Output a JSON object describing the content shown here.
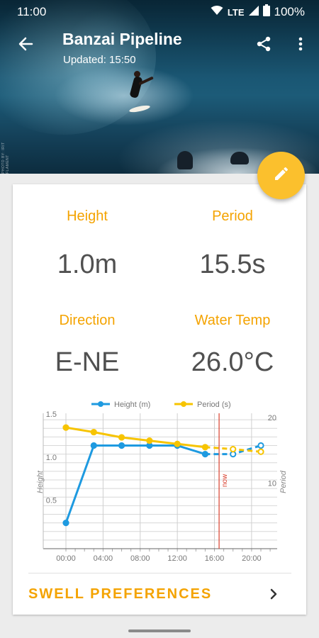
{
  "status_bar": {
    "time": "11:00",
    "network": "LTE",
    "battery": "100%"
  },
  "toolbar": {
    "title": "Banzai Pipeline",
    "updated": "Updated: 15:50"
  },
  "hero": {
    "photo_credit": "PHOTO BY: IRIT FLAMENT"
  },
  "stats": {
    "height_label": "Height",
    "height_value": "1.0m",
    "period_label": "Period",
    "period_value": "15.5s",
    "direction_label": "Direction",
    "direction_value": "E-NE",
    "water_temp_label": "Water Temp",
    "water_temp_value": "26.0°C"
  },
  "chart_data": {
    "type": "line",
    "x": [
      "00:00",
      "03:00",
      "06:00",
      "09:00",
      "12:00",
      "15:00",
      "18:00",
      "21:00"
    ],
    "xticks": [
      "00:00",
      "04:00",
      "08:00",
      "12:00",
      "16:00",
      "20:00"
    ],
    "xlim": [
      0,
      21
    ],
    "series": [
      {
        "name": "Height (m)",
        "axis": "left",
        "color": "#1e9ae0",
        "values": [
          0.3,
          1.2,
          1.2,
          1.2,
          1.2,
          1.1,
          1.1,
          1.2
        ]
      },
      {
        "name": "Period (s)",
        "axis": "right",
        "color": "#f7c400",
        "values": [
          18.5,
          17.8,
          17.0,
          16.5,
          16.0,
          15.5,
          15.2,
          14.8
        ]
      }
    ],
    "now_x": 16.5,
    "now_label": "now",
    "ylabel_left": "Height",
    "ylim_left": [
      0,
      1.6
    ],
    "yticks_left": [
      "0.5",
      "1.0",
      "1.5"
    ],
    "ylabel_right": "Period",
    "ylim_right": [
      0,
      21
    ],
    "yticks_right": [
      "10",
      "20"
    ],
    "legend_position": "top",
    "grid": true
  },
  "swell": {
    "label": "SWELL PREFERENCES"
  }
}
